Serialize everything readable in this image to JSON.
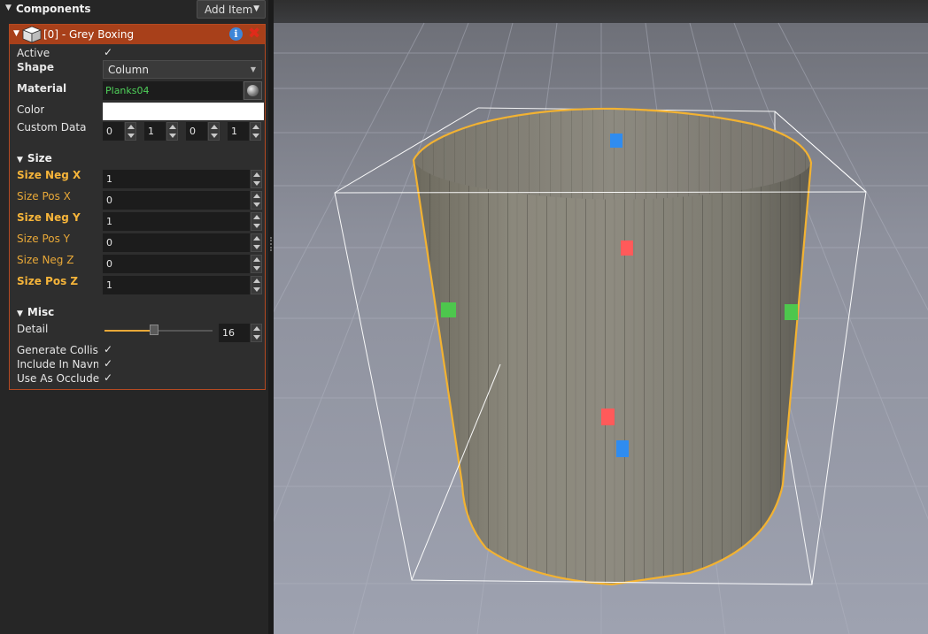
{
  "panel": {
    "title": "Components",
    "add_item_label": "Add Item"
  },
  "component": {
    "title": "[0] - Grey Boxing",
    "info_label": "i",
    "delete_label": "✖",
    "active_label": "Active",
    "active_checked": "✓",
    "shape_label": "Shape",
    "shape_value": "Column",
    "material_label": "Material",
    "material_value": "Planks04",
    "color_label": "Color",
    "color_value": "#ffffff",
    "custom_data_label": "Custom Data",
    "custom_data": [
      "0",
      "1",
      "0",
      "1"
    ]
  },
  "size_section": {
    "title": "Size",
    "fields": [
      {
        "label": "Size Neg X",
        "value": "1"
      },
      {
        "label": "Size Pos X",
        "value": "0"
      },
      {
        "label": "Size Neg Y",
        "value": "1"
      },
      {
        "label": "Size Pos Y",
        "value": "0"
      },
      {
        "label": "Size Neg Z",
        "value": "0"
      },
      {
        "label": "Size Pos Z",
        "value": "1"
      }
    ]
  },
  "misc_section": {
    "title": "Misc",
    "detail_label": "Detail",
    "detail_value": "16",
    "detail_slider_fraction": 0.46,
    "generate_collision_label": "Generate Collision",
    "include_navmesh_label": "Include In Navmesh",
    "use_as_occluder_label": "Use As Occluder",
    "check_mark": "✓"
  },
  "viewport": {
    "selection_color": "#f2b232",
    "handle_colors": {
      "x": "#4dc74d",
      "y": "#ff5a5a",
      "z": "#2f8cf0"
    }
  }
}
